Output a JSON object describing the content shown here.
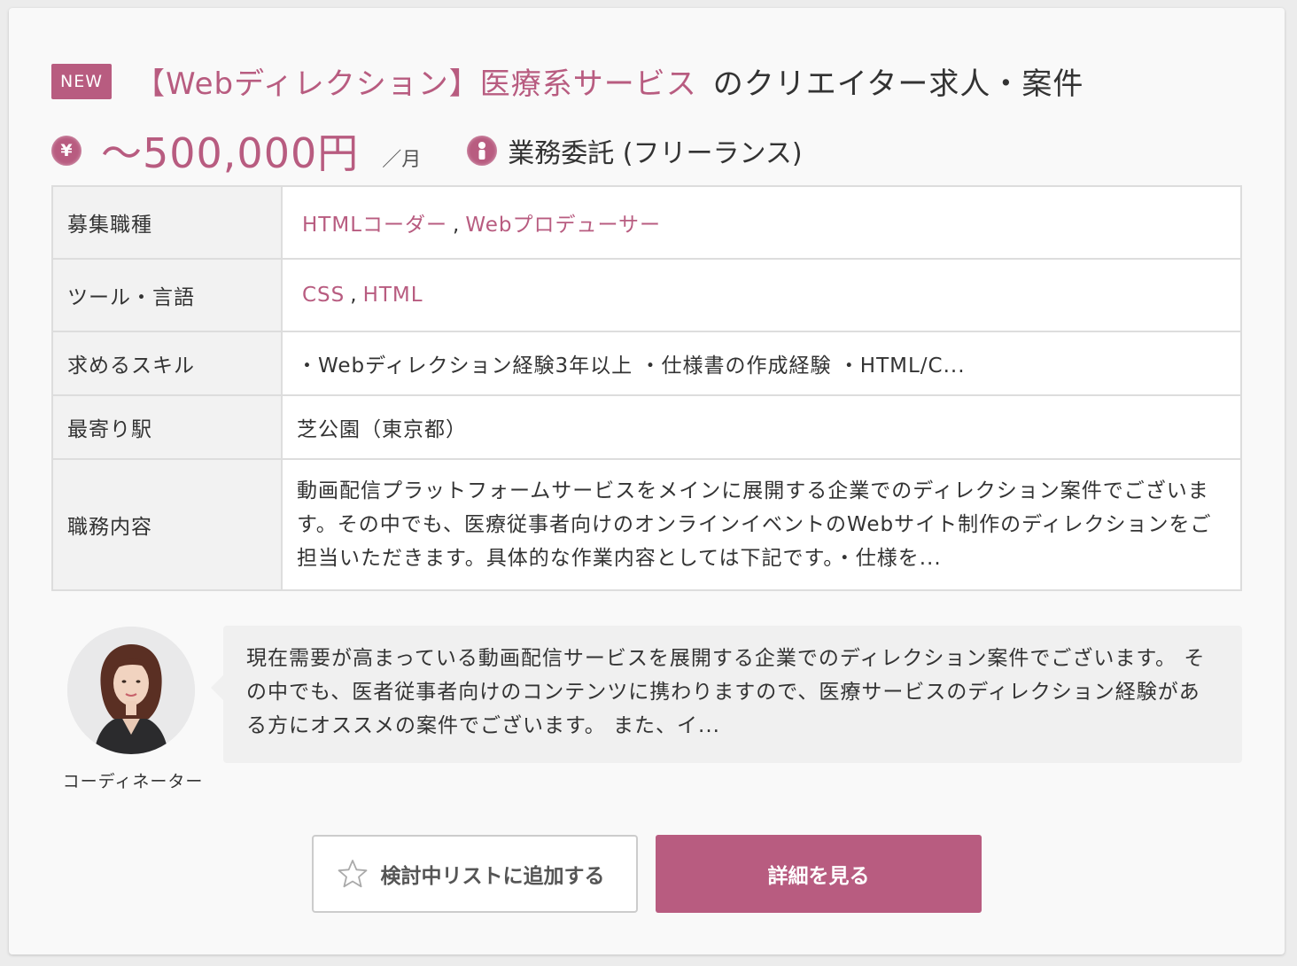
{
  "colors": {
    "accent": "#b85c80",
    "text": "#333333",
    "background": "#ececec"
  },
  "badge": "NEW",
  "title": {
    "accent": "【Webディレクション】医療系サービス",
    "rest": "のクリエイター求人・案件"
  },
  "salary": {
    "icon": "yen-icon",
    "symbol": "¥",
    "amount": "～500,000円",
    "unit": "／月"
  },
  "contract": {
    "icon": "person-icon",
    "label": "業務委託 (フリーランス)"
  },
  "details": {
    "job_type_label": "募集職種",
    "job_types": [
      "HTMLコーダー",
      "Webプロデューサー"
    ],
    "tools_label": "ツール・言語",
    "tools": [
      "CSS",
      "HTML"
    ],
    "separator": ",",
    "skills_label": "求めるスキル",
    "skills": "・Webディレクション経験3年以上 ・仕様書の作成経験 ・HTML/C...",
    "station_label": "最寄り駅",
    "station": "芝公園（東京都）",
    "duties_label": "職務内容",
    "duties": "動画配信プラットフォームサービスをメインに展開する企業でのディレクション案件でございます。その中でも、医療従事者向けのオンラインイベントのWebサイト制作のディレクションをご担当いただきます。具体的な作業内容としては下記です。・仕様を..."
  },
  "coordinator": {
    "label": "コーディネーター",
    "comment": "現在需要が高まっている動画配信サービスを展開する企業でのディレクション案件でございます。 その中でも、医者従事者向けのコンテンツに携わりますので、医療サービスのディレクション経験がある方にオススメの案件でございます。 また、イ..."
  },
  "buttons": {
    "favorite": "検討中リストに追加する",
    "detail": "詳細を見る"
  }
}
